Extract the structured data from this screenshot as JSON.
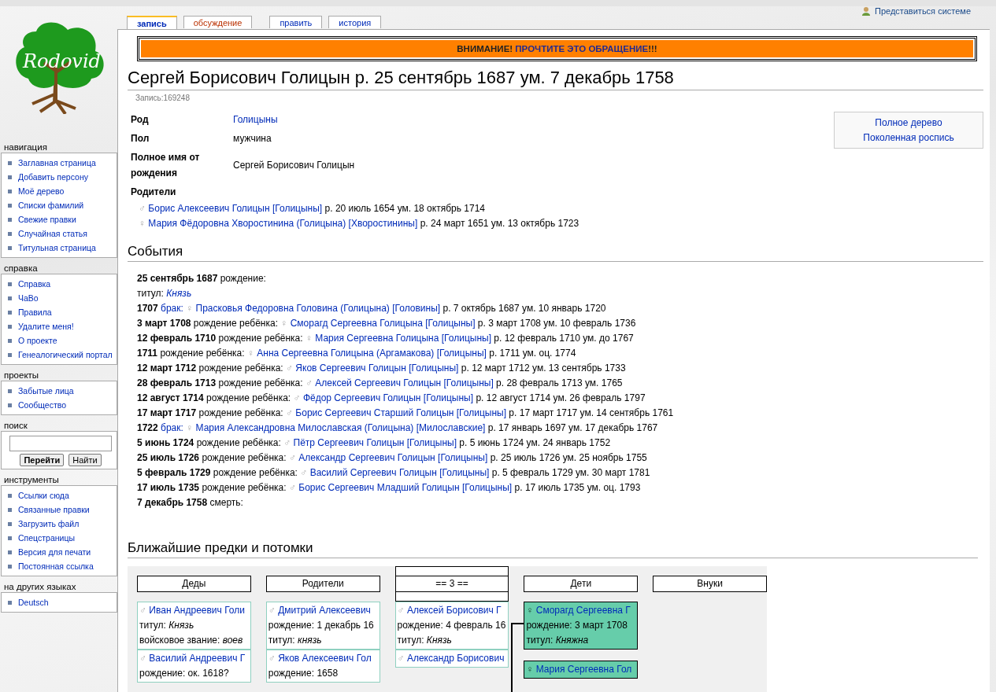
{
  "logo": {
    "text": "Rodovid"
  },
  "user_link": "Представиться системе",
  "tab_groups": [
    [
      {
        "label": "запись",
        "selected": true,
        "missing": false
      },
      {
        "label": "обсуждение",
        "selected": false,
        "missing": true
      }
    ],
    [
      {
        "label": "править",
        "selected": false,
        "missing": false
      },
      {
        "label": "история",
        "selected": false,
        "missing": false
      }
    ]
  ],
  "sidebar": [
    {
      "title": "навигация",
      "kind": "links",
      "items": [
        "Заглавная страница",
        "Добавить персону",
        "Моё дерево",
        "Списки фамилий",
        "Свежие правки",
        "Случайная статья",
        "Титульная страница"
      ]
    },
    {
      "title": "справка",
      "kind": "links",
      "items": [
        "Справка",
        "ЧаВо",
        "Правила",
        "Удалите меня!",
        "О проекте",
        "Генеалогический портал"
      ]
    },
    {
      "title": "проекты",
      "kind": "links",
      "items": [
        "Забытые лица",
        "Сообщество"
      ]
    },
    {
      "title": "поиск",
      "kind": "search",
      "buttons": [
        "Перейти",
        "Найти"
      ]
    },
    {
      "title": "инструменты",
      "kind": "links",
      "items": [
        "Ссылки сюда",
        "Связанные правки",
        "Загрузить файл",
        "Спецстраницы",
        "Версия для печати",
        "Постоянная ссылка"
      ]
    },
    {
      "title": "на других языках",
      "kind": "links",
      "items": [
        "Deutsch"
      ]
    }
  ],
  "banner": {
    "lead": "ВНИМАНИЕ!",
    "link": "ПРОЧТИТЕ ЭТО ОБРАЩЕНИЕ",
    "tail": "!!!"
  },
  "title": "Сергей Борисович Голицын р. 25 сентябрь 1687 ум. 7 декабрь 1758",
  "record_id": "Запись:169248",
  "info": [
    {
      "label": "Род",
      "value": "Голицыны",
      "link": true
    },
    {
      "label": "Пол",
      "value": "мужчина",
      "link": false
    },
    {
      "label": "Полное имя от рождения",
      "value": "Сергей Борисович Голицын",
      "link": false
    }
  ],
  "parents_label": "Родители",
  "parents": [
    {
      "sex": "♂",
      "name": "Борис Алексеевич Голицын",
      "family": "[Голицыны]",
      "dates": "р. 20 июль 1654 ум. 18 октябрь 1714"
    },
    {
      "sex": "♀",
      "name": "Мария Фёдоровна Хворостинина (Голицына)",
      "family": "[Хворостинины]",
      "dates": "р. 24 март 1651 ум. 13 октябрь 1723"
    }
  ],
  "tree_links": [
    "Полное дерево",
    "Поколенная роспись"
  ],
  "events_heading": "События",
  "events": [
    {
      "kind": "event",
      "date": "25 сентябрь 1687",
      "label": "рождение:",
      "label_link": false
    },
    {
      "kind": "attribute",
      "label": "титул:",
      "value": "Князь"
    },
    {
      "kind": "event",
      "date": "1707",
      "label": "брак:",
      "label_link": true,
      "sex": "♀",
      "person": "Прасковья Федоровна Головина (Голицына)",
      "family": "[Головины]",
      "dates": "р. 7 октябрь 1687 ум. 10 январь 1720"
    },
    {
      "kind": "event",
      "date": "3 март 1708",
      "label": "рождение ребёнка:",
      "label_link": false,
      "sex": "♀",
      "person": "Сморагд Сергеевна Голицына",
      "family": "[Голицыны]",
      "dates": "р. 3 март 1708 ум. 10 февраль 1736"
    },
    {
      "kind": "event",
      "date": "12 февраль 1710",
      "label": "рождение ребёнка:",
      "label_link": false,
      "sex": "♀",
      "person": "Мария Сергеевна Голицына",
      "family": "[Голицыны]",
      "dates": "р. 12 февраль 1710 ум. до 1767"
    },
    {
      "kind": "event",
      "date": "1711",
      "label": "рождение ребёнка:",
      "label_link": false,
      "sex": "♀",
      "person": "Анна Сергеевна Голицына (Аргамакова)",
      "family": "[Голицыны]",
      "dates": "р. 1711 ум. оц. 1774"
    },
    {
      "kind": "event",
      "date": "12 март 1712",
      "label": "рождение ребёнка:",
      "label_link": false,
      "sex": "♂",
      "person": "Яков Сергеевич Голицын",
      "family": "[Голицыны]",
      "dates": "р. 12 март 1712 ум. 13 сентябрь 1733"
    },
    {
      "kind": "event",
      "date": "28 февраль 1713",
      "label": "рождение ребёнка:",
      "label_link": false,
      "sex": "♂",
      "person": "Алексей Сергеевич Голицын",
      "family": "[Голицыны]",
      "dates": "р. 28 февраль 1713 ум. 1765"
    },
    {
      "kind": "event",
      "date": "12 август 1714",
      "label": "рождение ребёнка:",
      "label_link": false,
      "sex": "♂",
      "person": "Фёдор Сергеевич Голицын",
      "family": "[Голицыны]",
      "dates": "р. 12 август 1714 ум. 26 февраль 1797"
    },
    {
      "kind": "event",
      "date": "17 март 1717",
      "label": "рождение ребёнка:",
      "label_link": false,
      "sex": "♂",
      "person": "Борис Сергеевич Старший Голицын",
      "family": "[Голицыны]",
      "dates": "р. 17 март 1717 ум. 14 сентябрь 1761"
    },
    {
      "kind": "event",
      "date": "1722",
      "label": "брак:",
      "label_link": true,
      "sex": "♀",
      "person": "Мария Александровна Милославская (Голицына)",
      "family": "[Милославские]",
      "dates": "р. 17 январь 1697 ум. 17 декабрь 1767"
    },
    {
      "kind": "event",
      "date": "5 июнь 1724",
      "label": "рождение ребёнка:",
      "label_link": false,
      "sex": "♂",
      "person": "Пётр Сергеевич Голицын",
      "family": "[Голицыны]",
      "dates": "р. 5 июнь 1724 ум. 24 январь 1752"
    },
    {
      "kind": "event",
      "date": "25 июль 1726",
      "label": "рождение ребёнка:",
      "label_link": false,
      "sex": "♂",
      "person": "Александр Сергеевич Голицын",
      "family": "[Голицыны]",
      "dates": "р. 25 июль 1726 ум. 25 ноябрь 1755"
    },
    {
      "kind": "event",
      "date": "5 февраль 1729",
      "label": "рождение ребёнка:",
      "label_link": false,
      "sex": "♂",
      "person": "Василий Сергеевич Голицын",
      "family": "[Голицыны]",
      "dates": "р. 5 февраль 1729 ум. 30 март 1781"
    },
    {
      "kind": "event",
      "date": "17 июль 1735",
      "label": "рождение ребёнка:",
      "label_link": false,
      "sex": "♂",
      "person": "Борис Сергеевич Младший Голицын",
      "family": "[Голицыны]",
      "dates": "р. 17 июль 1735 ум. оц. 1793"
    },
    {
      "kind": "event",
      "date": "7 декабрь 1758",
      "label": "смерть:",
      "label_link": false
    }
  ],
  "relatives_heading": "Ближайшие предки и потомки",
  "tree_columns": [
    {
      "header": "Деды",
      "current": false,
      "cards": [
        {
          "sex": "♂",
          "name": "Иван Андреевич Голи",
          "lines": [
            "титул: *Князь*",
            "войсковое звание: *воев*"
          ],
          "highlighted": false
        },
        {
          "sex": "♂",
          "name": "Василий Андреевич Г",
          "lines": [
            "рождение: ок. 1618?"
          ],
          "highlighted": false
        }
      ]
    },
    {
      "header": "Родители",
      "current": false,
      "cards": [
        {
          "sex": "♂",
          "name": "Дмитрий Алексеевич",
          "lines": [
            "рождение: 1 декабрь 16",
            "титул: *князь*"
          ],
          "highlighted": false
        },
        {
          "sex": "♂",
          "name": "Яков Алексеевич Гол",
          "lines": [
            "рождение: 1658"
          ],
          "highlighted": false
        }
      ]
    },
    {
      "header": "== 3 ==",
      "current": true,
      "cards": [
        {
          "sex": "♂",
          "name": "Алексей Борисович Г",
          "lines": [
            "рождение: 4 февраль 16",
            "титул: *Князь*"
          ],
          "highlighted": false
        },
        {
          "sex": "♂",
          "name": "Александр Борисович",
          "highlighted": false
        }
      ]
    },
    {
      "header": "Дети",
      "current": false,
      "cards": [
        {
          "sex": "♀",
          "name": "Сморагд Сергеевна Г",
          "lines": [
            "рождение: 3 март 1708",
            "титул: *Княжна*"
          ],
          "highlighted": true
        },
        {
          "sex": "♀",
          "name": "Мария Сергеевна Гол",
          "highlighted": true
        }
      ]
    },
    {
      "header": "Внуки",
      "current": false
    }
  ]
}
